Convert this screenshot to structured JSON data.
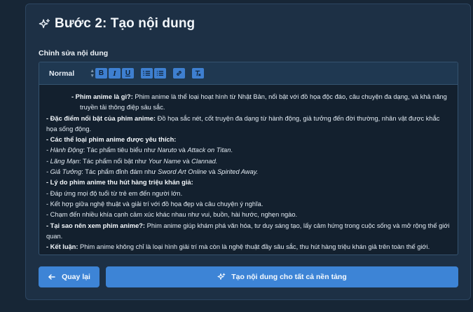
{
  "header": {
    "title": "Bước 2: Tạo nội dung"
  },
  "section": {
    "label": "Chỉnh sửa nội dung"
  },
  "toolbar": {
    "format_value": "Normal",
    "bold_label": "B",
    "italic_label": "I",
    "underline_label": "U"
  },
  "content": {
    "l1_b": "- Phim anime là gì?:",
    "l1_t": " Phim anime là thể loại hoạt hình từ Nhật Bản, nổi bật với đồ họa độc đáo, câu chuyện đa dạng, và khả năng truyền tải thông điệp sâu sắc.",
    "l2_b": "- Đặc điểm nổi bật của phim anime:",
    "l2_t": " Đồ họa sắc nét, cốt truyện đa dạng từ hành động, giả tưởng đến đời thường, nhân vật được khắc họa sống động.",
    "l3_b": "- Các thể loại phim anime được yêu thích:",
    "g1_name": " - Hành Động",
    "g1_t": ": Tác phẩm tiêu biểu như ",
    "g1_w1": "Naruto",
    "g1_and": " và ",
    "g1_w2": "Attack on Titan",
    "g1_end": ".",
    "g2_name": " - Lãng Mạn",
    "g2_t": ": Tác phẩm nổi bật như ",
    "g2_w1": "Your Name",
    "g2_and": " và ",
    "g2_w2": "Clannad.",
    "g3_name": " - Giả Tưởng",
    "g3_t": ": Tác phẩm đỉnh đám như ",
    "g3_w1": "Sword Art Online",
    "g3_and": " và ",
    "g3_w2": "Spirited Away.",
    "l4_b": "- Lý do phim anime thu hút hàng triệu khán giả:",
    "r1": " - Đáp ứng mọi độ tuổi từ trẻ em đến người lớn.",
    "r2": " - Kết hợp giữa nghệ thuật và giải trí với đồ họa đẹp và câu chuyện ý nghĩa.",
    "r3": " - Chạm đến nhiều khía cạnh cảm xúc khác nhau như vui, buồn, hài hước, nghẹn ngào.",
    "l5_b": "- Tại sao nên xem phim anime?:",
    "l5_t": " Phim anime giúp khám phá văn hóa, tư duy sáng tạo, lấy cảm hứng trong cuộc sống và mở rộng thế giới quan.",
    "l6_b": "- Kết luận:",
    "l6_t": " Phim anime không chỉ là loại hình giải trí mà còn là nghệ thuật đầy sâu sắc, thu hút hàng triệu khán giả trên toàn thế giới."
  },
  "actions": {
    "back_label": "Quay lại",
    "generate_label": "Tạo nội dung cho tất cả nền tảng"
  },
  "colors": {
    "accent": "#3d84d6",
    "background": "#172636",
    "card": "#1d3045"
  }
}
